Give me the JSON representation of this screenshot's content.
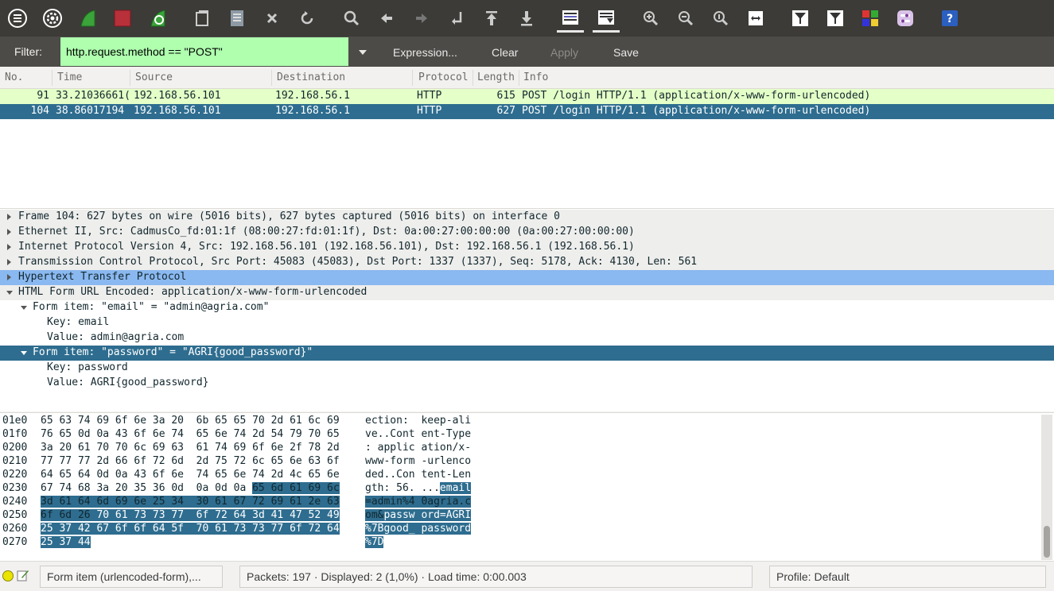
{
  "filter": {
    "label": "Filter:",
    "value": "http.request.method == \"POST\"",
    "expression_label": "Expression...",
    "clear_label": "Clear",
    "apply_label": "Apply",
    "save_label": "Save"
  },
  "packet_list": {
    "headers": [
      "No.",
      "Time",
      "Source",
      "Destination",
      "Protocol",
      "Length",
      "Info"
    ],
    "rows": [
      {
        "no": "91",
        "time": "33.21036661(",
        "source": "192.168.56.101",
        "destination": "192.168.56.1",
        "protocol": "HTTP",
        "length": "615",
        "info": "POST /login HTTP/1.1  (application/x-www-form-urlencoded)"
      },
      {
        "no": "104",
        "time": "38.86017194",
        "source": "192.168.56.101",
        "destination": "192.168.56.1",
        "protocol": "HTTP",
        "length": "627",
        "info": "POST /login HTTP/1.1  (application/x-www-form-urlencoded)"
      }
    ]
  },
  "details": [
    "Frame 104: 627 bytes on wire (5016 bits), 627 bytes captured (5016 bits) on interface 0",
    "Ethernet II, Src: CadmusCo_fd:01:1f (08:00:27:fd:01:1f), Dst: 0a:00:27:00:00:00 (0a:00:27:00:00:00)",
    "Internet Protocol Version 4, Src: 192.168.56.101 (192.168.56.101), Dst: 192.168.56.1 (192.168.56.1)",
    "Transmission Control Protocol, Src Port: 45083 (45083), Dst Port: 1337 (1337), Seq: 5178, Ack: 4130, Len: 561",
    "Hypertext Transfer Protocol",
    "HTML Form URL Encoded: application/x-www-form-urlencoded",
    "Form item: \"email\" = \"admin@agria.com\"",
    "Key: email",
    "Value: admin@agria.com",
    "Form item: \"password\" = \"AGRI{good_password}\"",
    "Key: password",
    "Value: AGRI{good_password}"
  ],
  "hex": {
    "offsets": [
      "01e0",
      "01f0",
      "0200",
      "0210",
      "0220",
      "0230",
      "0240",
      "0250",
      "0260",
      "0270"
    ],
    "row_01e0_bytes": "65 63 74 69 6f 6e 3a 20  6b 65 65 70 2d 61 6c 69",
    "row_01e0_ascii": "ection:  keep-ali",
    "row_01f0_bytes": "76 65 0d 0a 43 6f 6e 74  65 6e 74 2d 54 79 70 65",
    "row_01f0_ascii": "ve..Cont ent-Type",
    "row_0200_bytes": "3a 20 61 70 70 6c 69 63  61 74 69 6f 6e 2f 78 2d",
    "row_0200_ascii": ": applic ation/x-",
    "row_0210_bytes": "77 77 77 2d 66 6f 72 6d  2d 75 72 6c 65 6e 63 6f",
    "row_0210_ascii": "www-form -urlenco",
    "row_0220_bytes": "64 65 64 0d 0a 43 6f 6e  74 65 6e 74 2d 4c 65 6e",
    "row_0220_ascii": "ded..Con tent-Len",
    "row_0230_plain": "67 74 68 3a 20 35 36 0d  0a 0d 0a ",
    "row_0230_sel": "65 6d 61 69 6c",
    "row_0230_ascii_plain": "gth: 56. ...",
    "row_0230_ascii_sel": "email",
    "row_0240_sel": "3d 61 64 6d 69 6e 25 34  30 61 67 72 69 61 2e 63",
    "row_0240_ascii_sel": "=admin%4 0agria.c",
    "row_0250_sel": "6f 6d 26 ",
    "row_0250_bytes": "70 61 73 73 77  6f 72 64 3d 41 47 52 49",
    "row_0250_ascii_dim": "om&",
    "row_0250_ascii_sel": "passw ord=AGRI",
    "row_0260_bytes": "25 37 42 67 6f 6f 64 5f  70 61 73 73 77 6f 72 64",
    "row_0260_ascii": "%7Bgood_ password",
    "row_0270_bytes": "25 37 44",
    "row_0270_ascii": "%7D"
  },
  "status": {
    "field_info": "Form item (urlencoded-form),...",
    "packets": "Packets: 197 · Displayed: 2 (1,0%)  · Load time: 0:00.003",
    "profile": "Profile: Default"
  },
  "colors": {
    "toolbar_bg": "#3c3b37",
    "filter_valid": "#afffaf",
    "selection": "#2e6d8f",
    "http_row": "#e4ffc7"
  },
  "toolbar_icons": [
    "menu-icon",
    "options-icon",
    "start-capture-icon",
    "stop-capture-icon",
    "restart-capture-icon",
    "open-file-icon",
    "save-file-icon",
    "close-file-icon",
    "reload-icon",
    "find-packet-icon",
    "go-back-icon",
    "go-forward-icon",
    "go-to-packet-icon",
    "first-packet-icon",
    "last-packet-icon",
    "colorize-icon",
    "auto-scroll-icon",
    "zoom-in-icon",
    "zoom-out-icon",
    "normal-size-icon",
    "resize-columns-icon",
    "capture-filters-icon",
    "display-filters-icon",
    "coloring-rules-icon",
    "preferences-icon",
    "help-icon"
  ]
}
